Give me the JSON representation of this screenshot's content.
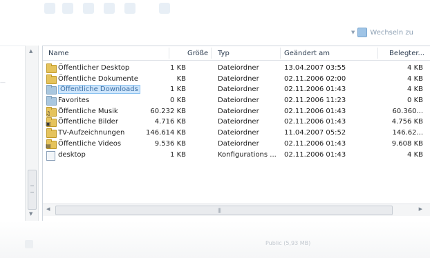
{
  "navigation": {
    "goto_label": "Wechseln zu"
  },
  "columns": {
    "name": "Name",
    "size": "Größe",
    "type": "Typ",
    "date": "Geändert am",
    "volume": "Belegter..."
  },
  "files": [
    {
      "name": "Öffentlicher Desktop",
      "size": "1 KB",
      "type": "Dateiordner",
      "date": "13.04.2007 03:55",
      "volume": "4 KB",
      "icon": "folder-icon",
      "selected": false
    },
    {
      "name": "Öffentliche Dokumente",
      "size": "KB",
      "type": "Dateiordner",
      "date": "02.11.2006 02:00",
      "volume": "4 KB",
      "icon": "folder-icon",
      "selected": false
    },
    {
      "name": "Öffentliche Downloads",
      "size": "1 KB",
      "type": "Dateiordner",
      "date": "02.11.2006 01:43",
      "volume": "4 KB",
      "icon": "folder-icon",
      "selected": true
    },
    {
      "name": "Favorites",
      "size": "0 KB",
      "type": "Dateiordner",
      "date": "02.11.2006 11:23",
      "volume": "0 KB",
      "icon": "folder-icon",
      "selected": false
    },
    {
      "name": "Öffentliche Musik",
      "size": "60.232 KB",
      "type": "Dateiordner",
      "date": "02.11.2006 01:43",
      "volume": "60.360...",
      "icon": "music-folder-icon",
      "selected": false
    },
    {
      "name": "Öffentliche Bilder",
      "size": "4.716 KB",
      "type": "Dateiordner",
      "date": "02.11.2006 01:43",
      "volume": "4.756 KB",
      "icon": "pictures-folder-icon",
      "selected": false
    },
    {
      "name": "TV-Aufzeichnungen",
      "size": "146.614 KB",
      "type": "Dateiordner",
      "date": "11.04.2007 05:52",
      "volume": "146.62...",
      "icon": "folder-icon",
      "selected": false
    },
    {
      "name": "Öffentliche Videos",
      "size": "9.536 KB",
      "type": "Dateiordner",
      "date": "02.11.2006 01:43",
      "volume": "9.608 KB",
      "icon": "video-folder-icon",
      "selected": false
    },
    {
      "name": "desktop",
      "size": "1 KB",
      "type": "Konfigurations ...",
      "date": "02.11.2006 01:43",
      "volume": "4 KB",
      "icon": "config-file-icon",
      "selected": false
    }
  ],
  "statusbar": {
    "text": "Public (5,93 MB)"
  }
}
